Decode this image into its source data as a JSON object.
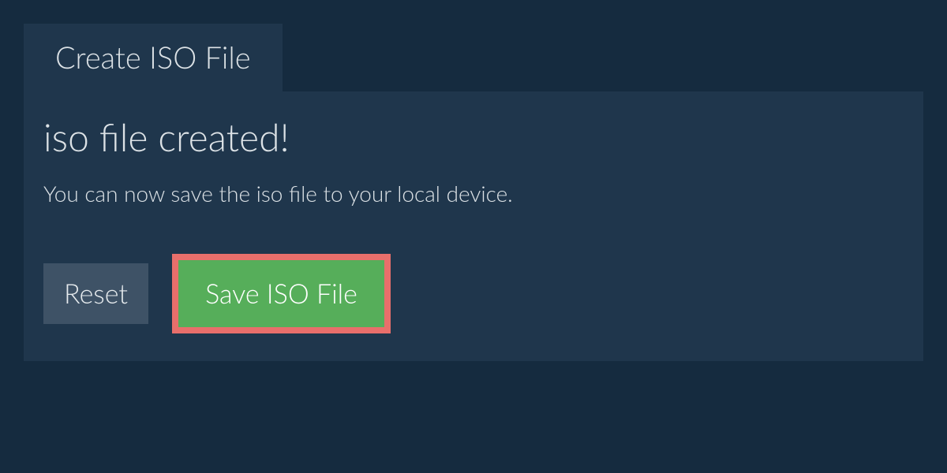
{
  "tab": {
    "label": "Create ISO File"
  },
  "main": {
    "heading": "iso file created!",
    "description": "You can now save the iso file to your local device."
  },
  "buttons": {
    "reset_label": "Reset",
    "save_label": "Save ISO File"
  },
  "colors": {
    "background": "#152b3f",
    "panel": "#1f364c",
    "text": "#dce2e6",
    "reset_bg": "#3e5266",
    "save_bg": "#56ae5a",
    "highlight_border": "#e86f6b"
  }
}
